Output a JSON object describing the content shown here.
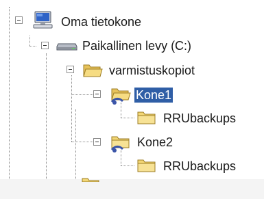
{
  "tree": {
    "nodes": [
      {
        "label": "Oma tietokone",
        "icon": "my-computer-icon",
        "expanded": true,
        "selected": false
      },
      {
        "label": "Paikallinen levy (C:)",
        "icon": "hard-drive-icon",
        "expanded": true,
        "selected": false
      },
      {
        "label": "varmistuskopiot",
        "icon": "folder-open-icon",
        "expanded": true,
        "selected": false
      },
      {
        "label": "Kone1",
        "icon": "shared-folder-open-icon",
        "expanded": true,
        "selected": true
      },
      {
        "label": "RRUbackups",
        "icon": "folder-icon",
        "expanded": false,
        "selected": false
      },
      {
        "label": "Kone2",
        "icon": "shared-folder-icon",
        "expanded": true,
        "selected": false
      },
      {
        "label": "RRUbackups",
        "icon": "folder-icon",
        "expanded": false,
        "selected": false
      }
    ]
  },
  "colors": {
    "selection": "#2f5ea6",
    "folder": "#f2d675",
    "tree_lines": "#8a8a8a"
  }
}
